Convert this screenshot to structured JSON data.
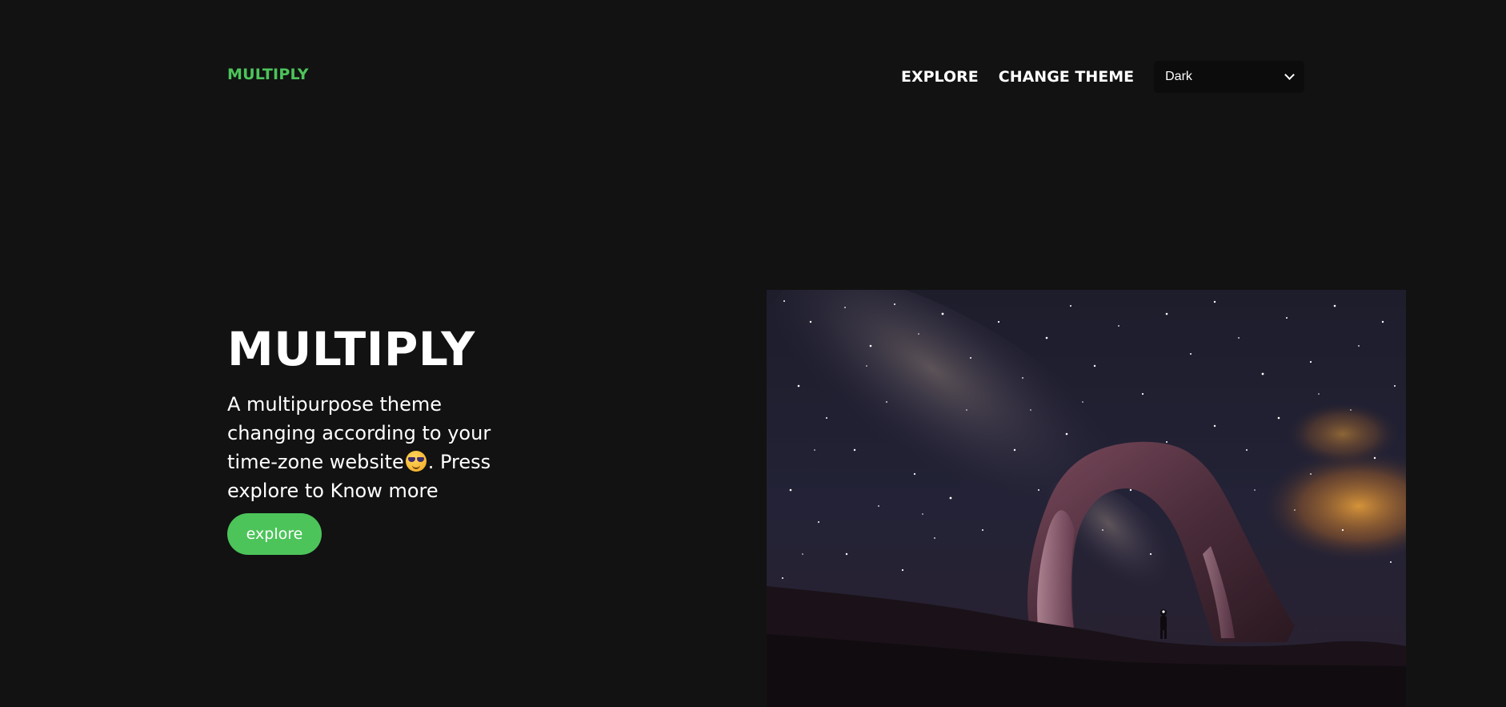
{
  "navbar": {
    "brand": "MULTIPLY",
    "links": [
      "EXPLORE",
      "CHANGE THEME"
    ],
    "theme_select": {
      "selected": "Dark"
    }
  },
  "hero": {
    "title": "MULTIPLY",
    "description_before_emoji": "A multipurpose theme changing according to your time-zone website",
    "description_after_emoji": ". Press explore to Know more",
    "button_label": "explore"
  },
  "icons": {
    "emoji": "smiling-face-with-sunglasses-icon",
    "select_caret": "chevron-down-icon"
  },
  "colors": {
    "background": "#121212",
    "accent": "#4cc45a",
    "text": "#ffffff",
    "select_background": "#0c0c0c"
  }
}
